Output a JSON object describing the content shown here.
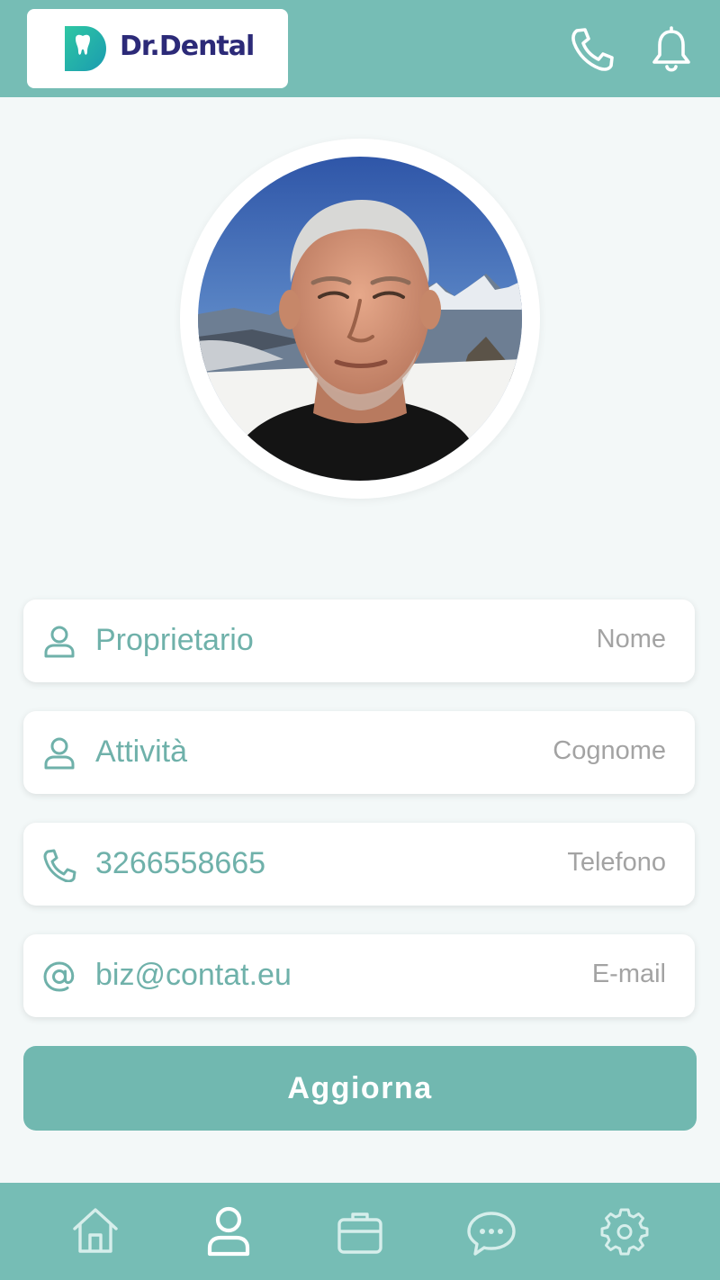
{
  "header": {
    "logo_text": "Dr.Dental",
    "phone_icon": "phone-icon",
    "bell_icon": "bell-icon"
  },
  "profile": {
    "avatar": "profile-photo"
  },
  "fields": [
    {
      "value": "Proprietario",
      "label": "Nome",
      "icon": "user-icon"
    },
    {
      "value": "Attività",
      "label": "Cognome",
      "icon": "user-icon"
    },
    {
      "value": "3266558665",
      "label": "Telefono",
      "icon": "phone-icon"
    },
    {
      "value": "biz@contat.eu",
      "label": "E-mail",
      "icon": "at-icon"
    }
  ],
  "button": {
    "label": "Aggiorna"
  },
  "nav": {
    "items": [
      "home-icon",
      "user-icon",
      "briefcase-icon",
      "chat-icon",
      "gear-icon"
    ],
    "active": "user-icon"
  },
  "colors": {
    "accent": "#76bdb5",
    "field_text": "#6fb1aa",
    "label_text": "#a3a3a3",
    "logo_text": "#2c2a78"
  }
}
